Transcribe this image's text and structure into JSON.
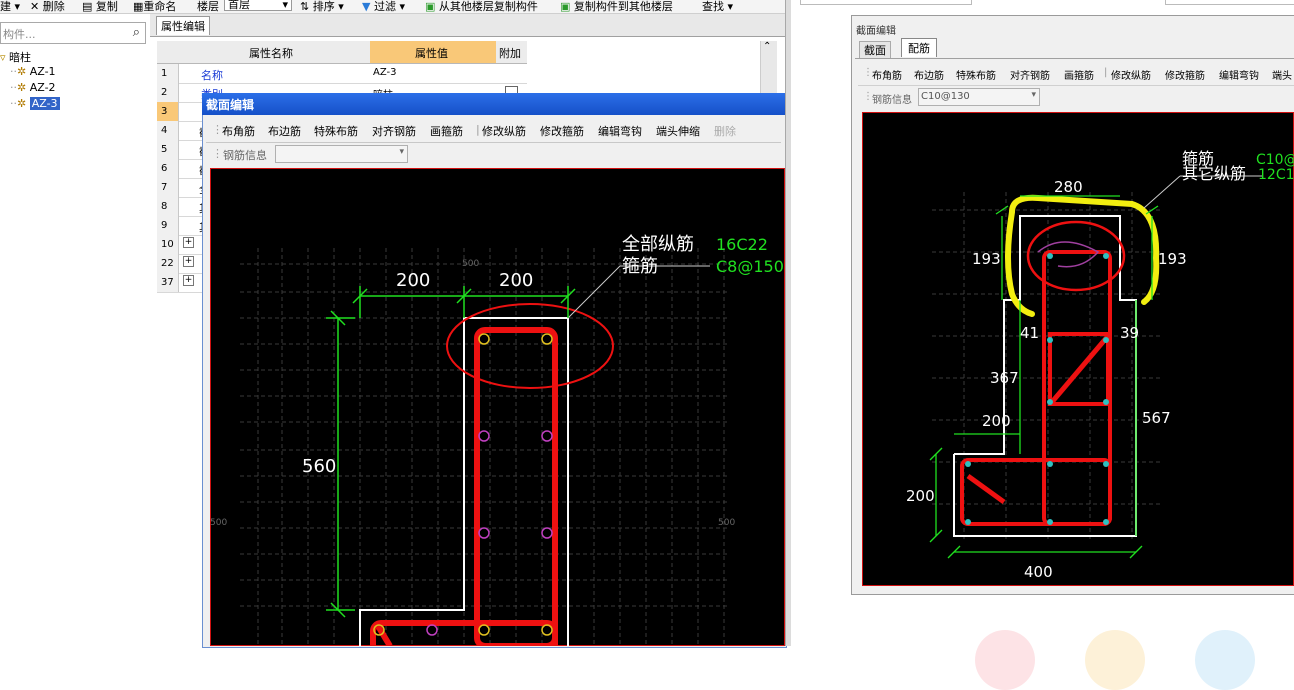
{
  "toolbar": {
    "new_label": "建",
    "delete_label": "删除",
    "copy_label": "复制",
    "rename_label": "重命名",
    "floor_label": "楼层",
    "floor_value": "首层",
    "sort_label": "排序",
    "filter_label": "过滤",
    "copy_from_floor_label": "从其他楼层复制构件",
    "copy_to_floor_label": "复制构件到其他楼层",
    "find_label": "查找"
  },
  "left_panel": {
    "search_placeholder": "构件...",
    "tree_root": "暗柱",
    "tree_items": [
      "AZ-1",
      "AZ-2",
      "AZ-3"
    ]
  },
  "property_panel": {
    "tab_label": "属性编辑",
    "col_name": "属性名称",
    "col_value": "属性值",
    "col_extra": "附加",
    "rows": [
      {
        "num": "1",
        "name": "名称",
        "value": "AZ-3"
      },
      {
        "num": "2",
        "name": "类别",
        "value": "暗柱"
      },
      {
        "num": "3",
        "name": "",
        "value": ""
      },
      {
        "num": "4",
        "name": "截",
        "value": ""
      },
      {
        "num": "5",
        "name": "截",
        "value": ""
      },
      {
        "num": "6",
        "name": "截",
        "value": ""
      },
      {
        "num": "7",
        "name": "全",
        "value": ""
      },
      {
        "num": "8",
        "name": "其",
        "value": ""
      },
      {
        "num": "9",
        "name": "其",
        "value": ""
      },
      {
        "num": "10",
        "name": "+",
        "value": ""
      },
      {
        "num": "22",
        "name": "+",
        "value": ""
      },
      {
        "num": "37",
        "name": "+",
        "value": ""
      }
    ]
  },
  "dialog_left": {
    "title": "截面编辑",
    "tools": [
      "布角筋",
      "布边筋",
      "特殊布筋",
      "对齐钢筋",
      "画箍筋",
      "修改纵筋",
      "修改箍筋",
      "编辑弯钩",
      "端头伸缩",
      "删除"
    ],
    "rebar_info_label": "钢筋信息",
    "rebar_info_value": "",
    "labels": {
      "all_long_bars": "全部纵筋",
      "stirrup": "箍筋",
      "long_bars_value": "16C22",
      "stirrup_value": "C8@150",
      "dim_200a": "200",
      "dim_200b": "200",
      "dim_560": "560",
      "grid_500_top": "500",
      "grid_500_left": "500",
      "grid_500_right": "500"
    }
  },
  "dialog_right": {
    "title": "截面编辑",
    "tabs": [
      "截面",
      "配筋"
    ],
    "tools": [
      "布角筋",
      "布边筋",
      "特殊布筋",
      "对齐钢筋",
      "画箍筋",
      "修改纵筋",
      "修改箍筋",
      "编辑弯钩",
      "端头"
    ],
    "rebar_info_label": "钢筋信息",
    "rebar_info_value": "C10@130",
    "labels": {
      "stirrup": "箍筋",
      "other_long_bars": "其它纵筋",
      "stirrup_value": "C10@",
      "other_value": "12C1",
      "dim_280": "280",
      "dim_193_left": "193",
      "dim_193_right": "193",
      "dim_41": "41",
      "dim_39": "39",
      "dim_367": "367",
      "dim_567": "567",
      "dim_200_top": "200",
      "dim_200_left": "200",
      "dim_400": "400"
    }
  },
  "colors": {
    "canvas_bg": "#000000",
    "dim_green": "#20e020",
    "rebar_red": "#ee1111",
    "outline_white": "#ffffff",
    "highlight_yellow": "#f2ee10",
    "dialog_title_blue": "#1a5fd6"
  }
}
